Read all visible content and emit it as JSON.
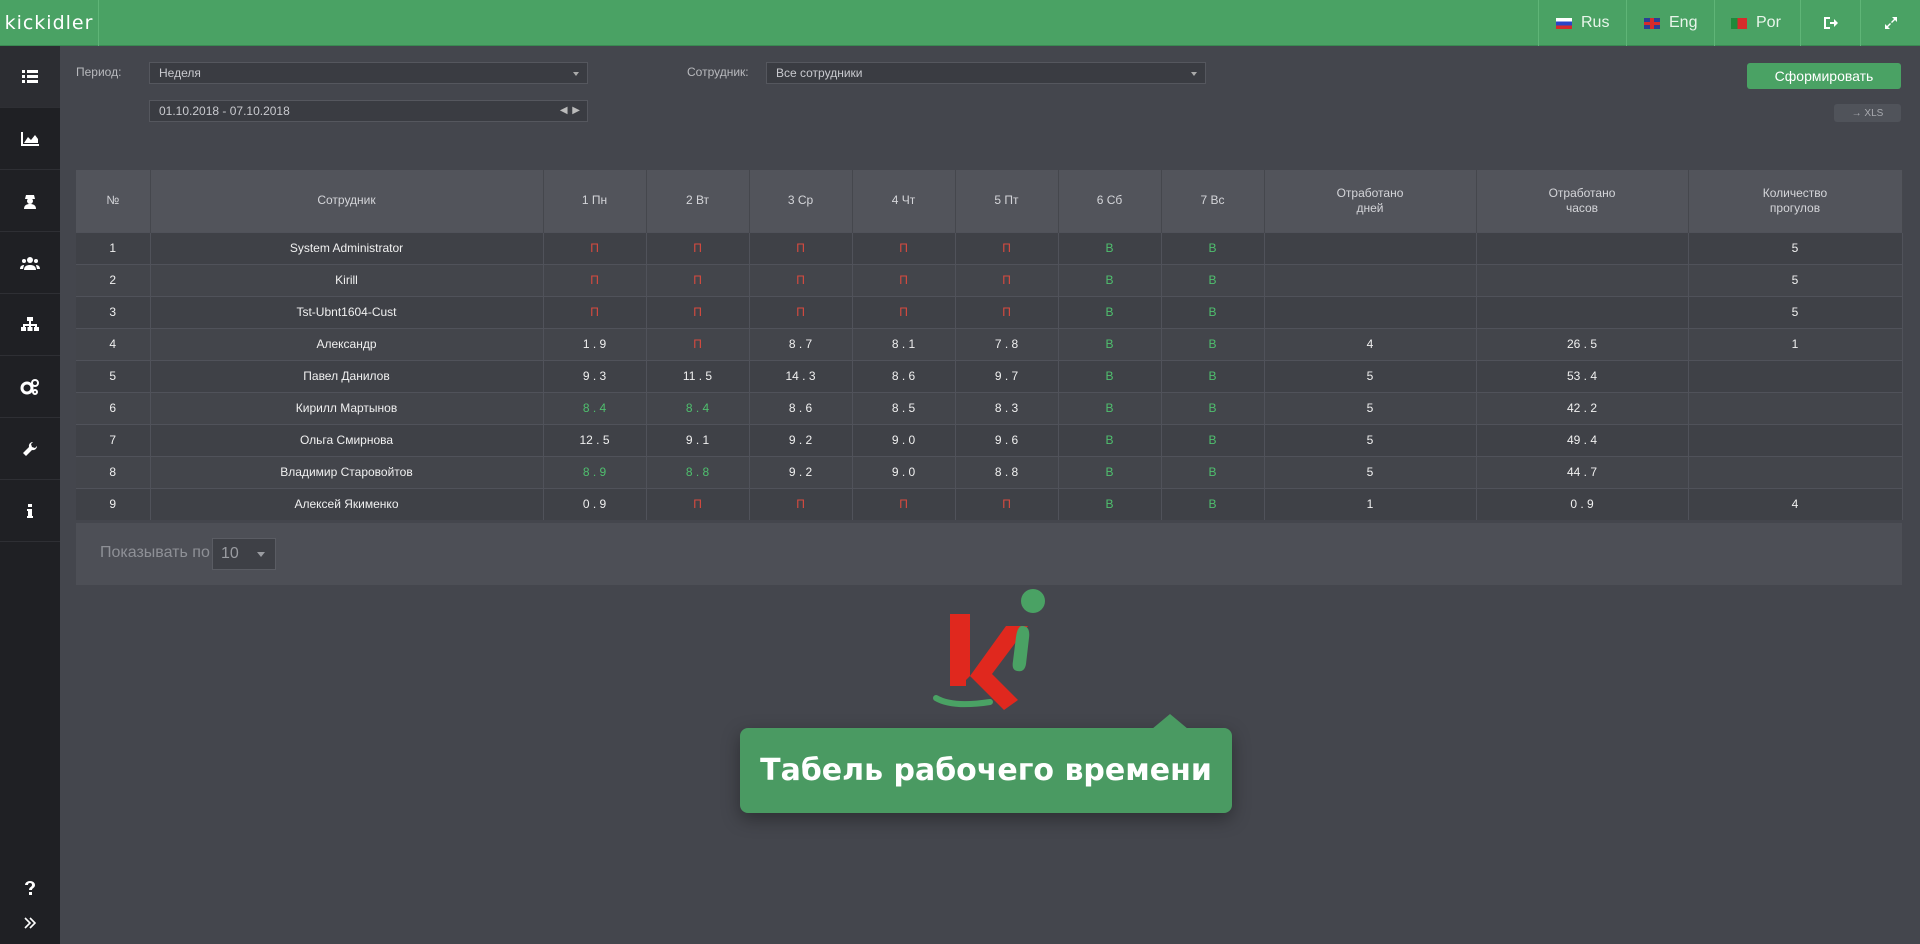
{
  "header": {
    "logo": "KICKIDLER",
    "languages": [
      {
        "label": "Rus",
        "flag": "flag-russia-icon"
      },
      {
        "label": "Eng",
        "flag": "flag-uk-icon"
      },
      {
        "label": "Por",
        "flag": "flag-portugal-icon"
      }
    ]
  },
  "sidebar": {
    "items": [
      "list-icon",
      "area-chart-icon",
      "user-secret-icon",
      "users-icon",
      "sitemap-icon",
      "gears-icon",
      "wrench-icon",
      "info-icon"
    ],
    "bottom": [
      "question-icon",
      "double-chevron-right-icon"
    ]
  },
  "filters": {
    "period_label": "Период:",
    "period_value": "Неделя",
    "employee_label": "Сотрудник:",
    "employee_value": "Все сотрудники",
    "date_range": "01.10.2018 - 07.10.2018",
    "date_arrows": "◀ ▶",
    "submit": "Сформировать",
    "export": "→ XLS"
  },
  "table": {
    "headers": [
      "№",
      "Сотрудник",
      "1 Пн",
      "2 Вт",
      "3 Ср",
      "4 Чт",
      "5 Пт",
      "6 Сб",
      "7 Вс",
      "Отработано\nдней",
      "Отработано\nчасов",
      "Количество\nпрогулов"
    ],
    "rows": [
      [
        "1",
        "System Administrator",
        "П",
        "П",
        "П",
        "П",
        "П",
        "В",
        "В",
        "",
        "",
        "5"
      ],
      [
        "2",
        "Kirill",
        "П",
        "П",
        "П",
        "П",
        "П",
        "В",
        "В",
        "",
        "",
        "5"
      ],
      [
        "3",
        "Tst-Ubnt1604-Cust",
        "П",
        "П",
        "П",
        "П",
        "П",
        "В",
        "В",
        "",
        "",
        "5"
      ],
      [
        "4",
        "Александр",
        "1 . 9",
        "П",
        "8 . 7",
        "8 . 1",
        "7 . 8",
        "В",
        "В",
        "4",
        "26 . 5",
        "1"
      ],
      [
        "5",
        "Павел Данилов",
        "9 . 3",
        "11 . 5",
        "14 . 3",
        "8 . 6",
        "9 . 7",
        "В",
        "В",
        "5",
        "53 . 4",
        ""
      ],
      [
        "6",
        "Кирилл Мартынов",
        "8 . 4",
        "8 . 4",
        "8 . 6",
        "8 . 5",
        "8 . 3",
        "В",
        "В",
        "5",
        "42 . 2",
        ""
      ],
      [
        "7",
        "Ольга Смирнова",
        "12 . 5",
        "9 . 1",
        "9 . 2",
        "9 . 0",
        "9 . 6",
        "В",
        "В",
        "5",
        "49 . 4",
        ""
      ],
      [
        "8",
        "Владимир Старовойтов",
        "8 . 9",
        "8 . 8",
        "9 . 2",
        "9 . 0",
        "8 . 8",
        "В",
        "В",
        "5",
        "44 . 7",
        ""
      ],
      [
        "9",
        "Алексей Якименко",
        "0 . 9",
        "П",
        "П",
        "П",
        "П",
        "В",
        "В",
        "1",
        "0 . 9",
        "4"
      ]
    ],
    "green_cells": [
      [
        5,
        2
      ],
      [
        5,
        3
      ],
      [
        7,
        2
      ],
      [
        7,
        3
      ]
    ]
  },
  "pager": {
    "label": "Показывать по",
    "value": "10"
  },
  "tooltip": {
    "text": "Табель рабочего времени"
  },
  "colors": {
    "accent": "#4aa264",
    "absence": "#d94a3f",
    "weekend": "#4fbf6e"
  }
}
